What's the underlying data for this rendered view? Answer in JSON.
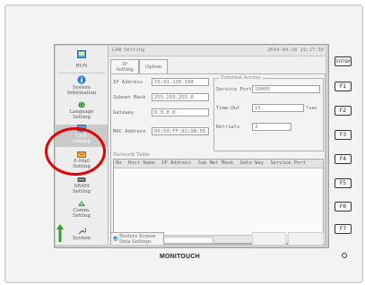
{
  "sidebar": {
    "items": [
      {
        "label": "RUN",
        "icon": "run-icon"
      },
      {
        "label": "System\nInformation",
        "icon": "info-icon"
      },
      {
        "label": "Language\nSetting",
        "icon": "language-icon"
      },
      {
        "label": "LAN\nSetting",
        "icon": "lan-icon"
      },
      {
        "label": "E-Mail\nSetting",
        "icon": "email-icon"
      },
      {
        "label": "SRAM\nSetting",
        "icon": "sram-icon"
      },
      {
        "label": "Comm.\nSetting",
        "icon": "comm-icon"
      },
      {
        "label": "System",
        "icon": "system-icon"
      }
    ]
  },
  "window": {
    "title": "LAN Setting",
    "datetime": "2014-04-18 19:17:30"
  },
  "tabs": [
    "IP\nSetting",
    "Option"
  ],
  "ip": {
    "ip_label": "IP Address",
    "ip_value": "10.91.130.198",
    "mask_label": "Subnet Mask",
    "mask_value": "255.255.255.0",
    "gw_label": "Gateway",
    "gw_value": "0.0.0.0",
    "mac_label": "MAC Address",
    "mac_value": "00:50:FF:02:9B:5E"
  },
  "external": {
    "title": "External Access",
    "port_label": "Service Port",
    "port_value": "10000",
    "timeout_label": "Time-Out",
    "timeout_value": "15",
    "timeout_unit": "*sec",
    "retries_label": "Retrials",
    "retries_value": "3"
  },
  "network_table": {
    "title": "Network Table",
    "headers": [
      "No",
      "Host Name",
      "IP Address",
      "Sub Net Mask",
      "Gate Way",
      "Service Port"
    ]
  },
  "restore_button": "Restore Screen\nData Settings",
  "fkeys": [
    "SYSTEM",
    "F1",
    "F2",
    "F3",
    "F4",
    "F5",
    "F6",
    "F7"
  ],
  "brand": "MONITOUCH",
  "colors": {
    "highlight": "#e00000"
  }
}
